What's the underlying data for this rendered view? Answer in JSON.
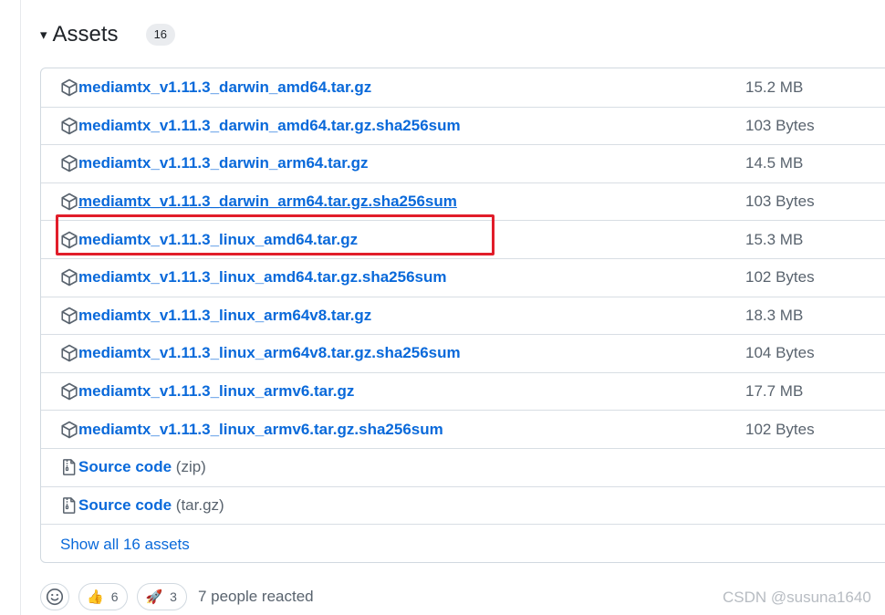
{
  "assets": {
    "caret": "▾",
    "title": "Assets",
    "count": "16",
    "files": [
      {
        "name": "mediamtx_v1.11.3_darwin_amd64.tar.gz",
        "size": "15.2 MB"
      },
      {
        "name": "mediamtx_v1.11.3_darwin_amd64.tar.gz.sha256sum",
        "size": "103 Bytes"
      },
      {
        "name": "mediamtx_v1.11.3_darwin_arm64.tar.gz",
        "size": "14.5 MB"
      },
      {
        "name": "mediamtx_v1.11.3_darwin_arm64.tar.gz.sha256sum",
        "size": "103 Bytes"
      },
      {
        "name": "mediamtx_v1.11.3_linux_amd64.tar.gz",
        "size": "15.3 MB"
      },
      {
        "name": "mediamtx_v1.11.3_linux_amd64.tar.gz.sha256sum",
        "size": "102 Bytes"
      },
      {
        "name": "mediamtx_v1.11.3_linux_arm64v8.tar.gz",
        "size": "18.3 MB"
      },
      {
        "name": "mediamtx_v1.11.3_linux_arm64v8.tar.gz.sha256sum",
        "size": "104 Bytes"
      },
      {
        "name": "mediamtx_v1.11.3_linux_armv6.tar.gz",
        "size": "17.7 MB"
      },
      {
        "name": "mediamtx_v1.11.3_linux_armv6.tar.gz.sha256sum",
        "size": "102 Bytes"
      }
    ],
    "source_code": [
      {
        "label": "Source code",
        "format": "(zip)"
      },
      {
        "label": "Source code",
        "format": "(tar.gz)"
      }
    ],
    "show_all": "Show all 16 assets"
  },
  "reactions": {
    "thumbs_up": {
      "emoji": "👍",
      "count": "6"
    },
    "rocket": {
      "emoji": "🚀",
      "count": "3"
    },
    "summary": "7 people reacted"
  },
  "watermark": "CSDN @susuna1640",
  "colors": {
    "link": "#0969da",
    "muted": "#59636e",
    "highlight": "#e11d2a",
    "border": "#d1d9e0"
  }
}
